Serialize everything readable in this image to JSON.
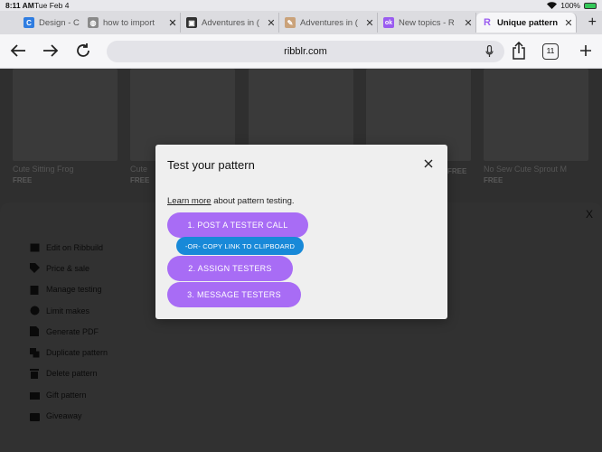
{
  "status": {
    "time": "8:11 AM",
    "date": "Tue Feb 4",
    "battery": "100%"
  },
  "tabs": [
    {
      "title": "Design - C",
      "color": "#2f7de1",
      "glyph": "C"
    },
    {
      "title": "how to import",
      "color": "#8a8a8a",
      "glyph": "◍"
    },
    {
      "title": "Adventures in (",
      "color": "#303030",
      "glyph": "▣"
    },
    {
      "title": "Adventures in (",
      "color": "#caa27a",
      "glyph": "✎"
    },
    {
      "title": "New topics - R",
      "color": "#9a5cf0",
      "glyph": "ok"
    },
    {
      "title": "Unique pattern",
      "color": "#9a5cf0",
      "glyph": "R"
    }
  ],
  "toolbar": {
    "url": "ribblr.com",
    "tab_count": "11"
  },
  "cards": [
    {
      "name": "Cute Sitting Frog",
      "price": "FREE"
    },
    {
      "name": "Cute",
      "price": "FREE"
    },
    {
      "name": "",
      "price": ""
    },
    {
      "name": "",
      "price": "FREE"
    },
    {
      "name": "No Sew Cute Sprout M",
      "price": "FREE"
    }
  ],
  "panel": {
    "close": "X",
    "menu": [
      {
        "label": "Edit on Ribbuild",
        "icon": "ribbuild-icon"
      },
      {
        "label": "Price & sale",
        "icon": "price-tag-icon"
      },
      {
        "label": "Manage testing",
        "icon": "clipboard-icon"
      },
      {
        "label": "Limit makes",
        "icon": "limit-icon"
      },
      {
        "label": "Generate PDF",
        "icon": "pdf-icon"
      },
      {
        "label": "Duplicate pattern",
        "icon": "duplicate-icon"
      },
      {
        "label": "Delete pattern",
        "icon": "trash-icon"
      },
      {
        "label": "Gift pattern",
        "icon": "gift-icon"
      },
      {
        "label": "Giveaway",
        "icon": "giveaway-icon"
      }
    ]
  },
  "modal": {
    "title": "Test your pattern",
    "learn_more": "Learn more",
    "intro_rest": " about pattern testing.",
    "btn_post": "1. POST A TESTER CALL",
    "btn_copy": "-OR- COPY LINK TO CLIPBOARD",
    "btn_assign": "2. ASSIGN TESTERS",
    "btn_message": "3. MESSAGE TESTERS",
    "accent": "#a86cf5",
    "copy_color": "#1889d8"
  }
}
